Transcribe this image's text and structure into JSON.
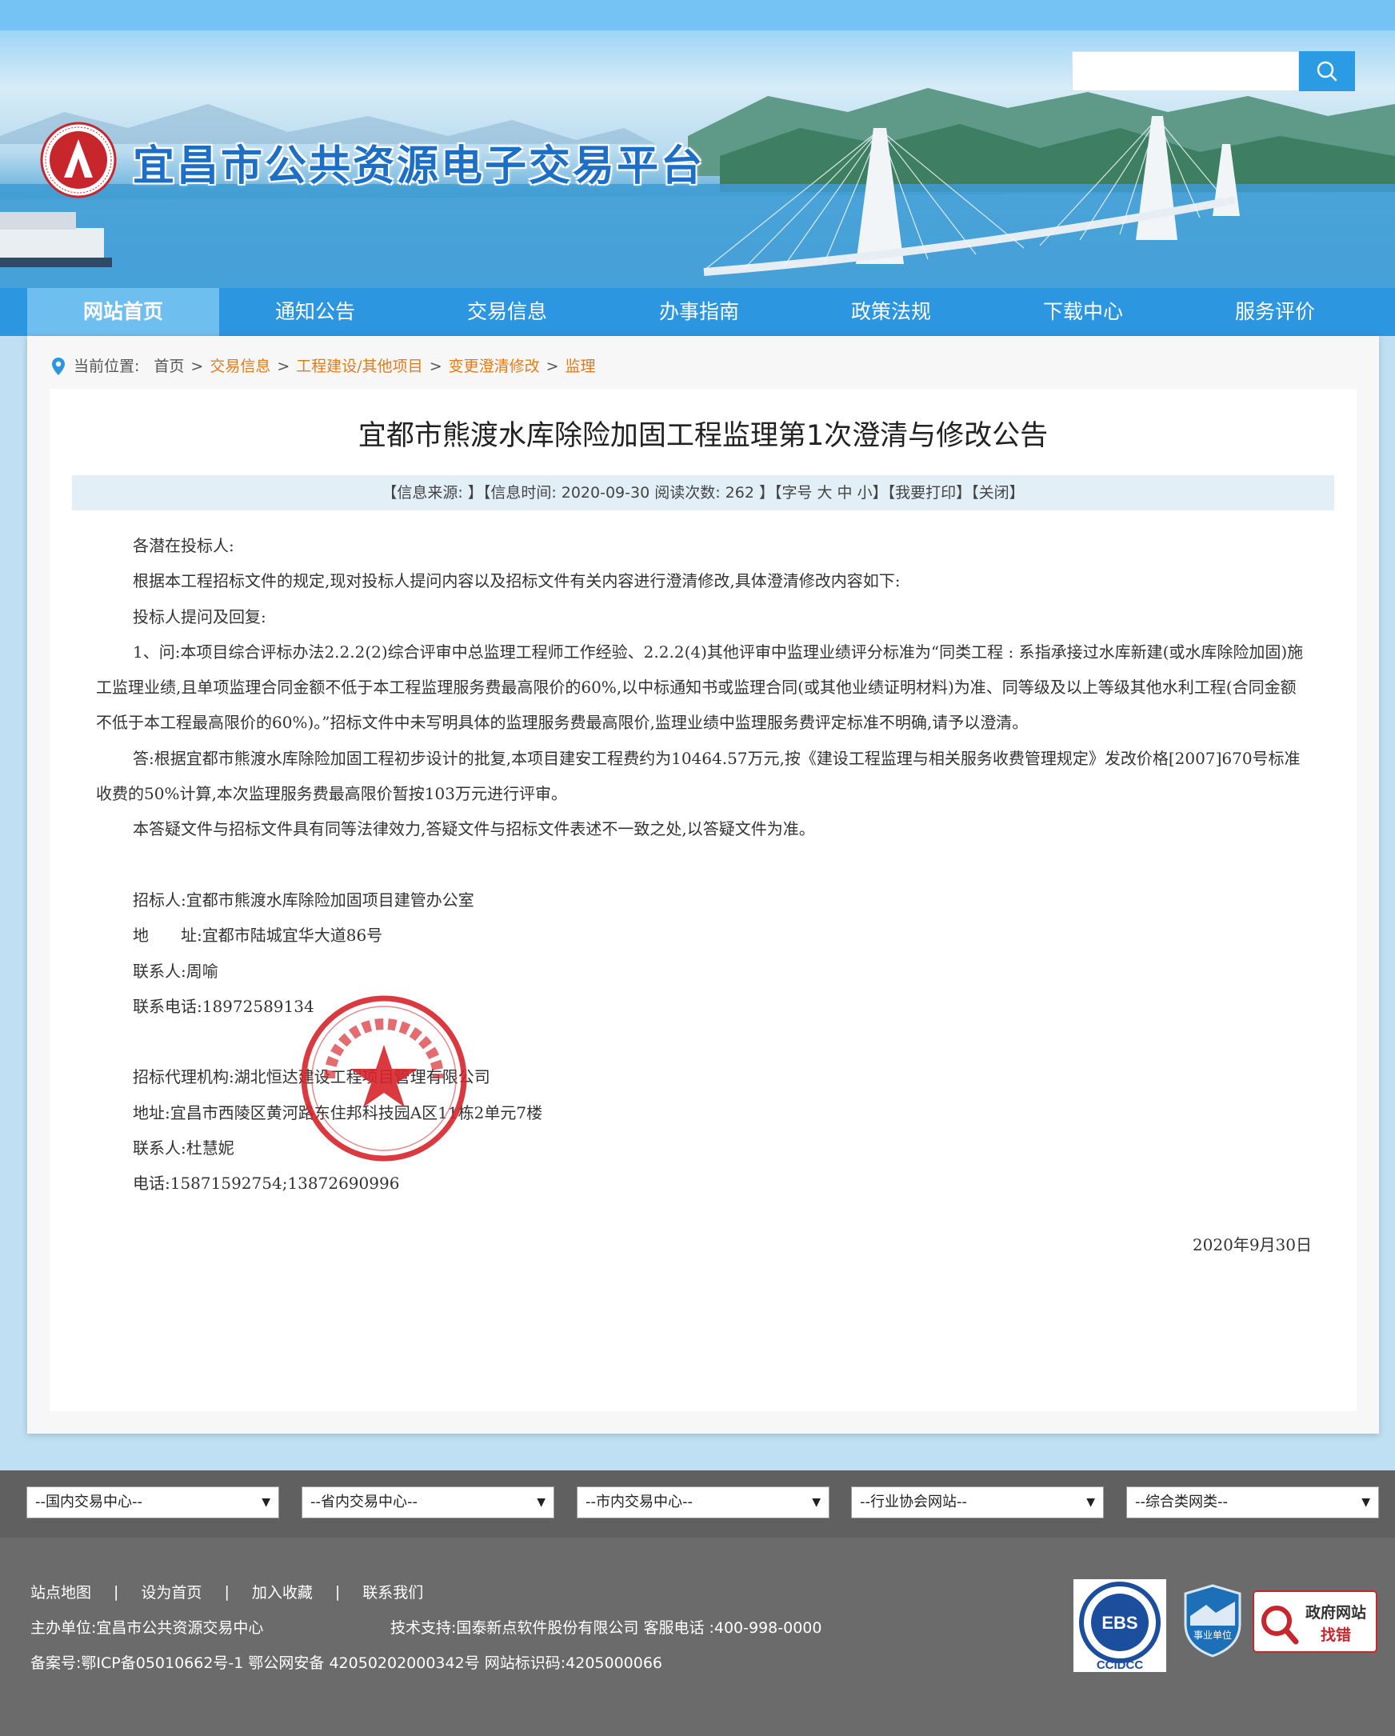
{
  "header": {
    "site_title": "宜昌市公共资源电子交易平台",
    "search_placeholder": ""
  },
  "nav": {
    "items": [
      "网站首页",
      "通知公告",
      "交易信息",
      "办事指南",
      "政策法规",
      "下载中心",
      "服务评价"
    ],
    "active_index": 0
  },
  "breadcrumb": {
    "label": "当前位置:",
    "home": "首页",
    "links": [
      "交易信息",
      "工程建设/其他项目",
      "变更澄清修改",
      "监理"
    ]
  },
  "article": {
    "title": "宜都市熊渡水库除险加固工程监理第1次澄清与修改公告",
    "meta": {
      "source": "【信息来源: 】",
      "time": "【信息时间: 2020-09-30 阅读次数: 262 】",
      "font_size": "【字号 大 中 小】",
      "print": "【我要打印】",
      "close": "【关闭】"
    },
    "greeting": "各潜在投标人:",
    "intro": "根据本工程招标文件的规定,现对投标人提问内容以及招标文件有关内容进行澄清修改,具体澄清修改内容如下:",
    "qa_heading": "投标人提问及回复:",
    "question": "1、问:本项目综合评标办法2.2.2(2)综合评审中总监理工程师工作经验、2.2.2(4)其他评审中监理业绩评分标准为“同类工程 : 系指承接过水库新建(或水库除险加固)施工监理业绩,且单项监理合同金额不低于本工程监理服务费最高限价的60%,以中标通知书或监理合同(或其他业绩证明材料)为准、同等级及以上等级其他水利工程(合同金额不低于本工程最高限价的60%)。”招标文件中未写明具体的监理服务费最高限价,监理业绩中监理服务费评定标准不明确,请予以澄清。",
    "answer": "答:根据宜都市熊渡水库除险加固工程初步设计的批复,本项目建安工程费约为10464.57万元,按《建设工程监理与相关服务收费管理规定》发改价格[2007]670号标准收费的50%计算,本次监理服务费最高限价暂按103万元进行评审。",
    "validity": "本答疑文件与招标文件具有同等法律效力,答疑文件与招标文件表述不一致之处,以答疑文件为准。",
    "tenderer": "招标人:宜都市熊渡水库除险加固项目建管办公室",
    "tenderer_address": "地　　址:宜都市陆城宜华大道86号",
    "tenderer_contact": "联系人:周喻",
    "tenderer_phone": "联系电话:18972589134",
    "agency": "招标代理机构:湖北恒达建设工程项目管理有限公司",
    "agency_address": "地址:宜昌市西陵区黄河路东住邦科技园A区11栋2单元7楼",
    "agency_contact": "联系人:杜慧妮",
    "agency_phone": "电话:15871592754;13872690996",
    "date": "2020年9月30日"
  },
  "footer": {
    "selects": [
      "--国内交易中心--",
      "--省内交易中心--",
      "--市内交易中心--",
      "--行业协会网站--",
      "--综合类网类--"
    ],
    "links": [
      "站点地图",
      "设为首页",
      "加入收藏",
      "联系我们"
    ],
    "host": "主办单位:宜昌市公共资源交易中心",
    "support": "技术支持:国泰新点软件股份有限公司 客服电话 :400-998-0000",
    "record": "备案号:鄂ICP备05010662号-1  鄂公网安备 42050202000342号  网站标识码:4205000066",
    "badges": {
      "ebs_top": "EBS",
      "ebs_bottom": "CCIDCC",
      "public_unit": "事业单位",
      "gov_error_line1": "政府网站",
      "gov_error_line2": "找错"
    }
  },
  "colors": {
    "nav_bg": "#2d96e0",
    "nav_active": "#6fbef0",
    "breadcrumb_link": "#e37b1a",
    "footer_bg": "#6b6b6b",
    "stamp_red": "#d8242c"
  }
}
